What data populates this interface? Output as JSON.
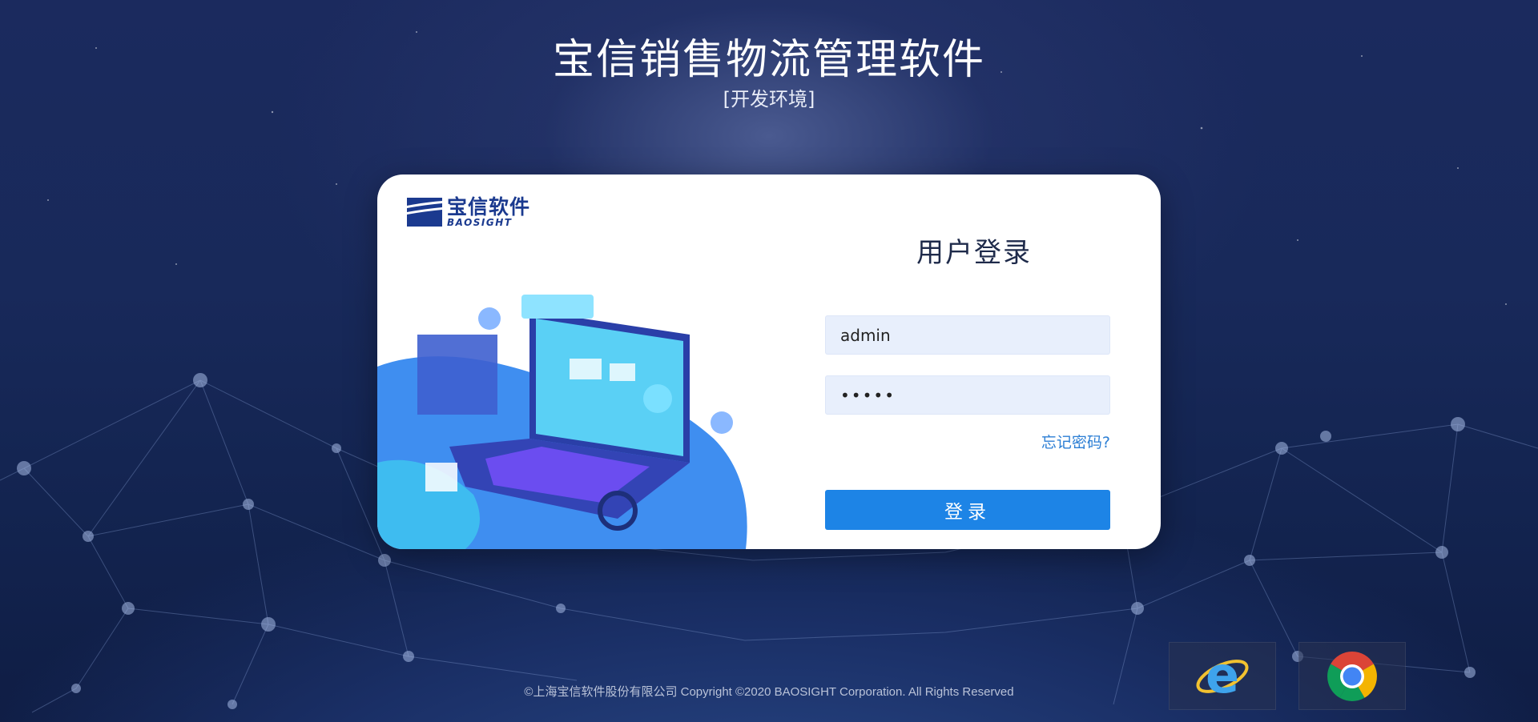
{
  "header": {
    "title": "宝信销售物流管理软件",
    "env": "[开发环境]"
  },
  "logo": {
    "name_cn": "宝信软件",
    "name_en": "BAOSIGHT"
  },
  "login": {
    "title": "用户登录",
    "username": "admin",
    "password": "•••••",
    "forgot_label": "忘记密码?",
    "submit_label": "登录"
  },
  "footer": {
    "copyright": "©上海宝信软件股份有限公司 Copyright ©2020 BAOSIGHT Corporation. All Rights Reserved"
  },
  "browsers": [
    {
      "name": "ie-icon"
    },
    {
      "name": "chrome-icon"
    }
  ],
  "colors": {
    "background": "#18295a",
    "accent": "#1d84e6",
    "field_bg": "#e8effc",
    "brand": "#1b3a8f"
  }
}
